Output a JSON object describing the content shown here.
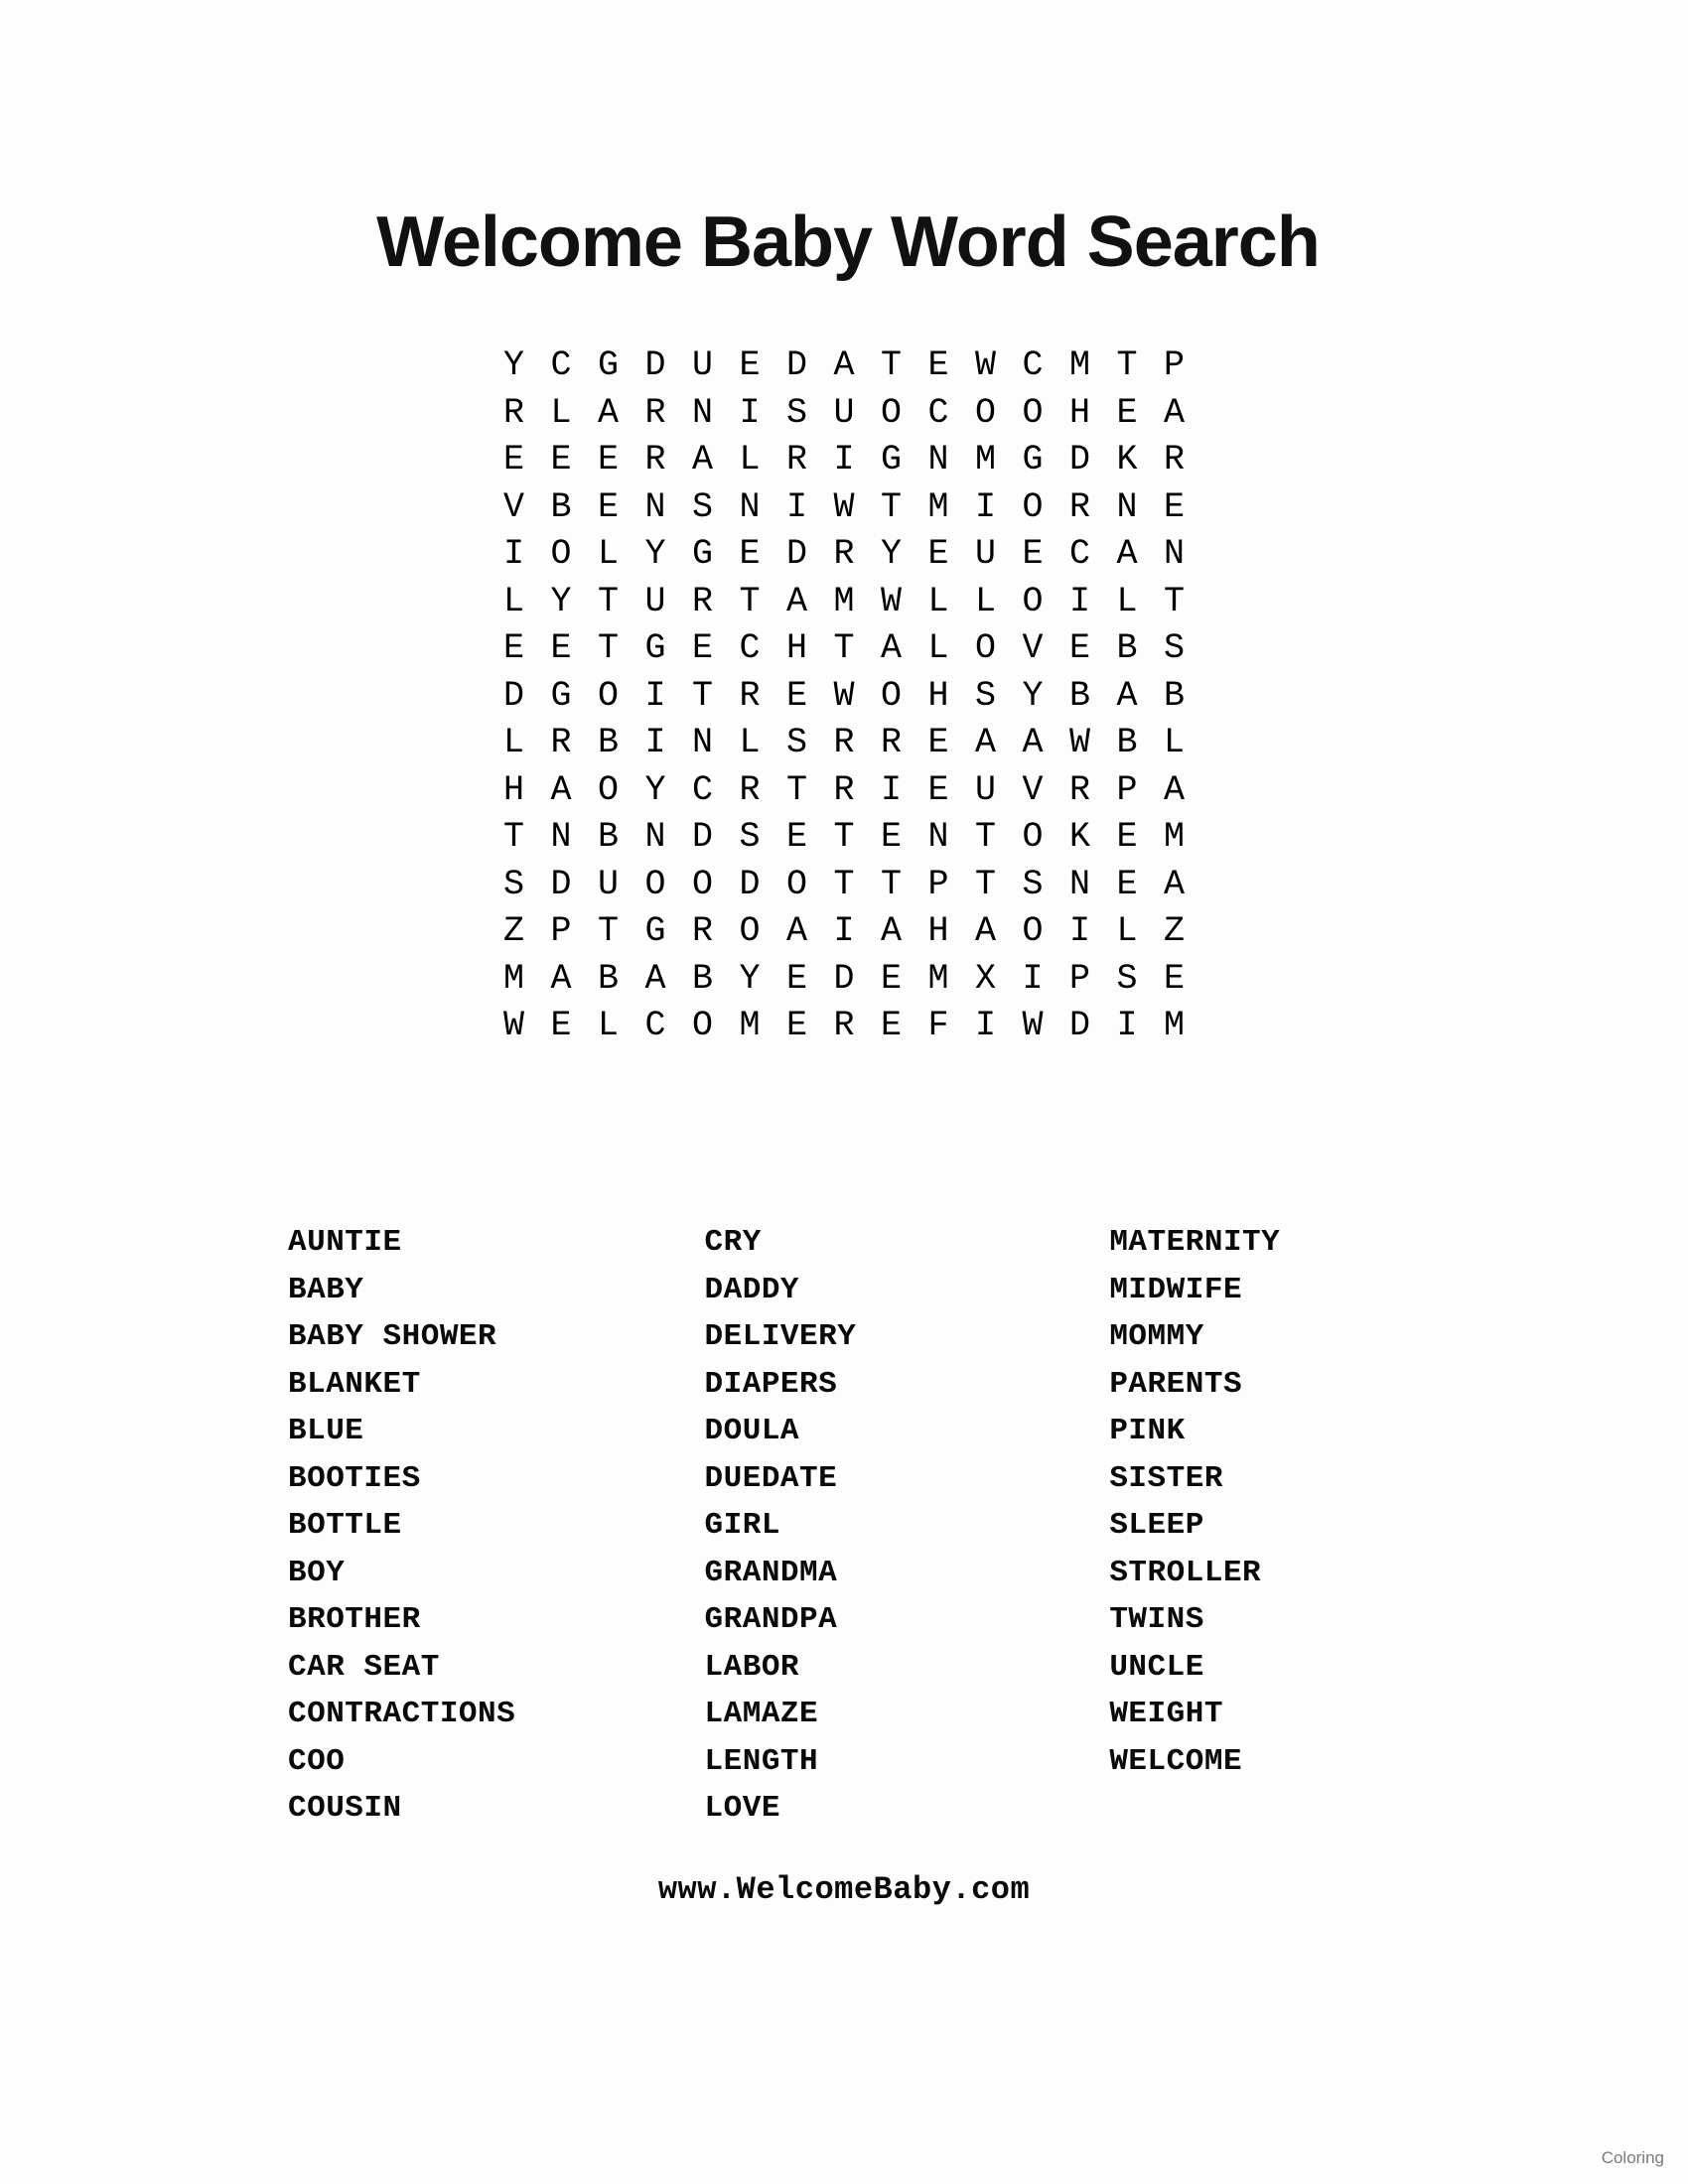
{
  "document": {
    "title": "Welcome Baby Word Search",
    "footer_url": "www.WelcomeBaby.com",
    "watermark": "Coloring"
  },
  "puzzle": {
    "rows": 15,
    "columns": 14,
    "grid": [
      [
        "Y",
        "C",
        "G",
        "D",
        "U",
        "E",
        "D",
        "A",
        "T",
        "E",
        "W",
        "C",
        "M",
        "T",
        "P"
      ],
      [
        "R",
        "L",
        "A",
        "R",
        "N",
        "I",
        "S",
        "U",
        "O",
        "C",
        "O",
        "O",
        "H",
        "E",
        "A"
      ],
      [
        "E",
        "E",
        "E",
        "R",
        "A",
        "L",
        "R",
        "I",
        "G",
        "N",
        "M",
        "G",
        "D",
        "K",
        "R"
      ],
      [
        "V",
        "B",
        "E",
        "N",
        "S",
        "N",
        "I",
        "W",
        "T",
        "M",
        "I",
        "O",
        "R",
        "N",
        "E"
      ],
      [
        "I",
        "O",
        "L",
        "Y",
        "G",
        "E",
        "D",
        "R",
        "Y",
        "E",
        "U",
        "E",
        "C",
        "A",
        "N"
      ],
      [
        "L",
        "Y",
        "T",
        "U",
        "R",
        "T",
        "A",
        "M",
        "W",
        "L",
        "L",
        "O",
        "I",
        "L",
        "T"
      ],
      [
        "E",
        "E",
        "T",
        "G",
        "E",
        "C",
        "H",
        "T",
        "A",
        "L",
        "O",
        "V",
        "E",
        "B",
        "S"
      ],
      [
        "D",
        "G",
        "O",
        "I",
        "T",
        "R",
        "E",
        "W",
        "O",
        "H",
        "S",
        "Y",
        "B",
        "A",
        "B"
      ],
      [
        "L",
        "R",
        "B",
        "I",
        "N",
        "L",
        "S",
        "R",
        "R",
        "E",
        "A",
        "A",
        "W",
        "B",
        "L"
      ],
      [
        "H",
        "A",
        "O",
        "Y",
        "C",
        "R",
        "T",
        "R",
        "I",
        "E",
        "U",
        "V",
        "R",
        "P",
        "A"
      ],
      [
        "T",
        "N",
        "B",
        "N",
        "D",
        "S",
        "E",
        "T",
        "E",
        "N",
        "T",
        "O",
        "K",
        "E",
        "M"
      ],
      [
        "S",
        "D",
        "U",
        "O",
        "O",
        "D",
        "O",
        "T",
        "T",
        "P",
        "T",
        "S",
        "N",
        "E",
        "A"
      ],
      [
        "Z",
        "P",
        "T",
        "G",
        "R",
        "O",
        "A",
        "I",
        "A",
        "H",
        "A",
        "O",
        "I",
        "L",
        "Z"
      ],
      [
        "M",
        "A",
        "B",
        "A",
        "B",
        "Y",
        "E",
        "D",
        "E",
        "M",
        "X",
        "I",
        "P",
        "S",
        "E"
      ],
      [
        "W",
        "E",
        "L",
        "C",
        "O",
        "M",
        "E",
        "R",
        "E",
        "F",
        "I",
        "W",
        "D",
        "I",
        "M"
      ]
    ]
  },
  "word_list": {
    "columns": [
      {
        "words": [
          "AUNTIE",
          "BABY",
          "BABY SHOWER",
          "BLANKET",
          "BLUE",
          "BOOTIES",
          "BOTTLE",
          "BOY",
          "BROTHER",
          "CAR SEAT",
          "CONTRACTIONS",
          "COO",
          "COUSIN"
        ]
      },
      {
        "words": [
          "CRY",
          "DADDY",
          "DELIVERY",
          "DIAPERS",
          "DOULA",
          "DUEDATE",
          "GIRL",
          "GRANDMA",
          "GRANDPA",
          "LABOR",
          "LAMAZE",
          "LENGTH",
          "LOVE"
        ]
      },
      {
        "words": [
          "MATERNITY",
          "MIDWIFE",
          "MOMMY",
          "PARENTS",
          "PINK",
          "SISTER",
          "SLEEP",
          "STROLLER",
          "TWINS",
          "UNCLE",
          "WEIGHT",
          "WELCOME"
        ]
      }
    ]
  },
  "colors": {
    "page_background": "#fdfdfd",
    "text": "#000000",
    "watermark": "#7a7a7a"
  }
}
